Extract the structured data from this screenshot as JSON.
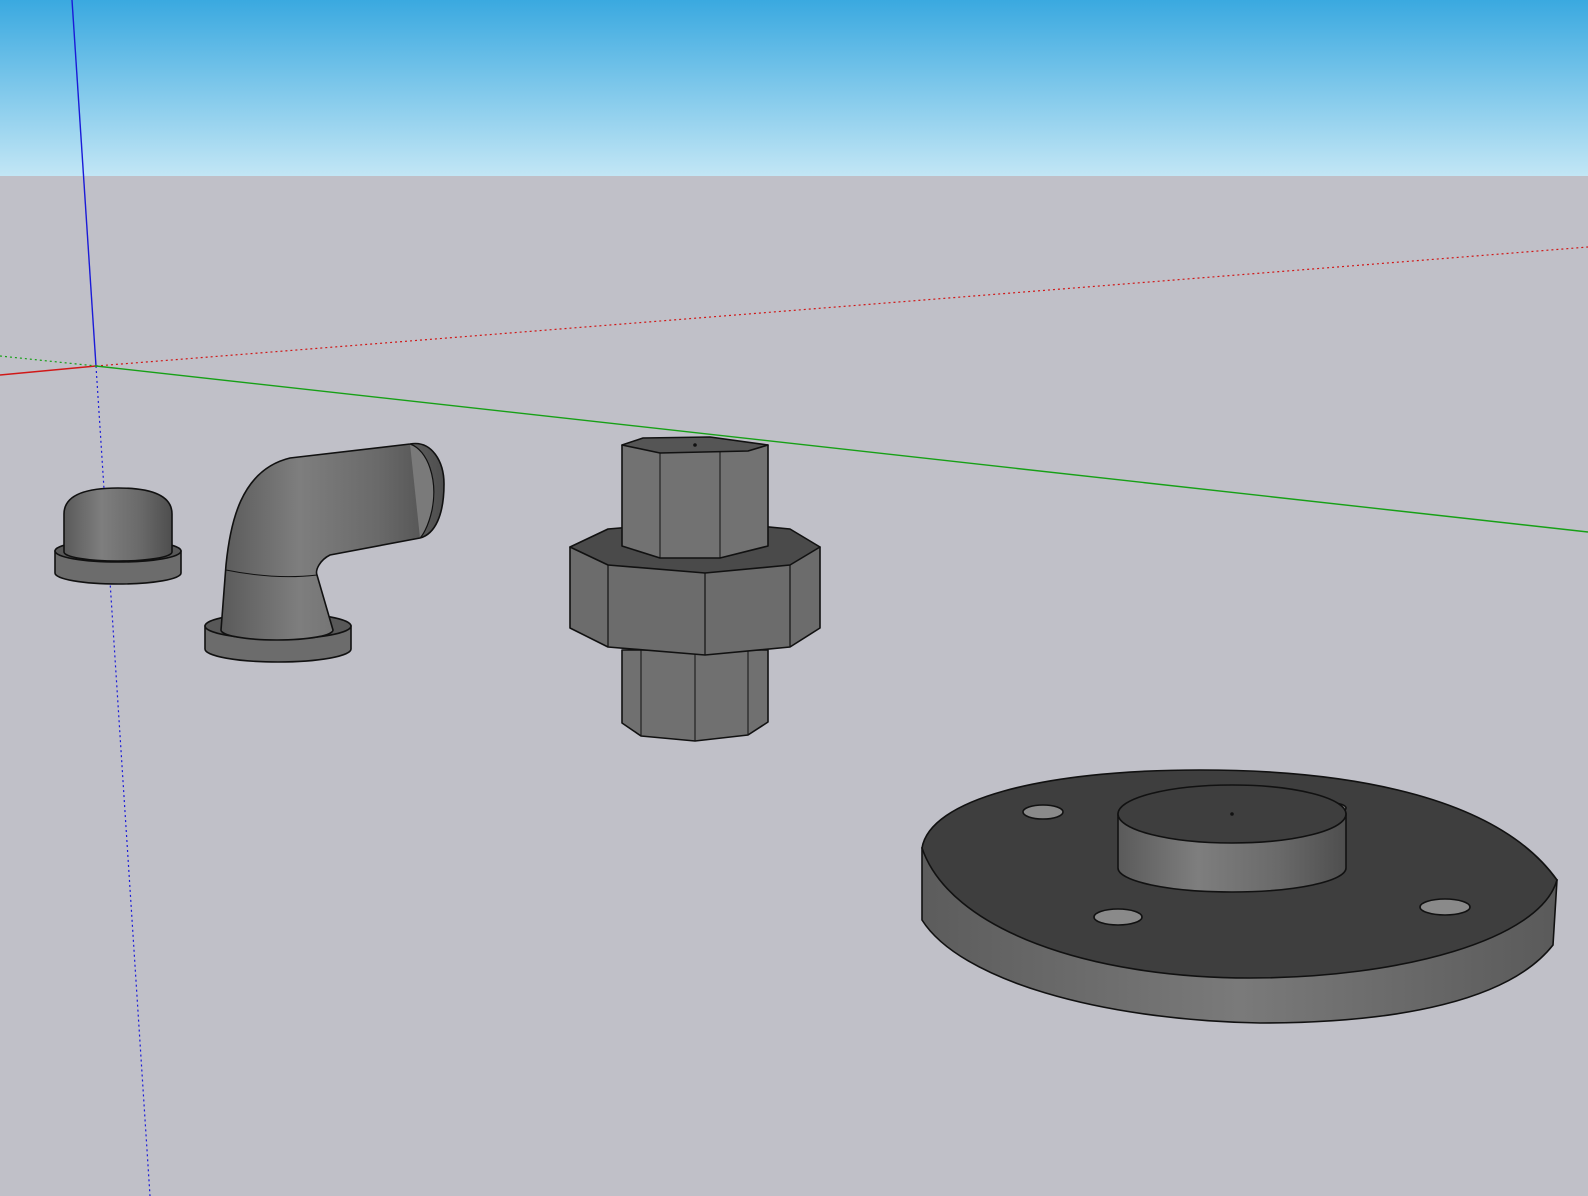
{
  "viewport": {
    "sky_top_color": "#3aa9e0",
    "sky_bottom_color": "#c2e6f5",
    "ground_color": "#c0c0c8"
  },
  "axes": {
    "red_color": "#d01818",
    "green_color": "#16a016",
    "blue_color": "#1a1ad8"
  },
  "model": {
    "parts": [
      {
        "name": "pipe-cap",
        "icon": "cap-shape"
      },
      {
        "name": "pipe-elbow-90",
        "icon": "elbow-shape"
      },
      {
        "name": "pipe-union",
        "icon": "hex-union-shape"
      },
      {
        "name": "floor-flange",
        "icon": "flange-shape"
      }
    ],
    "material_color": "#6e6e6e",
    "edge_color": "#111111"
  }
}
